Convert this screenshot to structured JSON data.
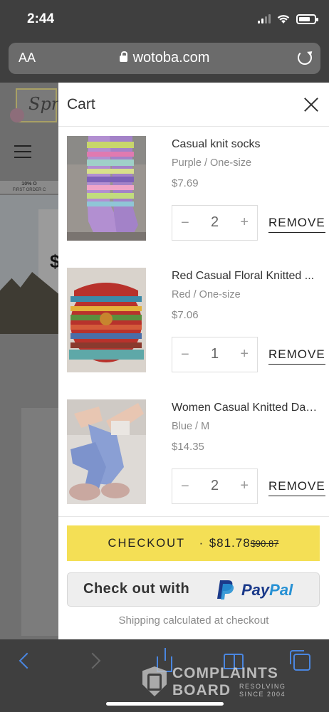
{
  "status_bar": {
    "time": "2:44"
  },
  "browser": {
    "text_size_label": "AA",
    "url": "wotoba.com"
  },
  "background_page": {
    "logo_text": "Spr",
    "promo_line_1": "10% O",
    "promo_line_2": "FIRST ORDER C",
    "hero_text": "$"
  },
  "cart": {
    "title": "Cart",
    "items": [
      {
        "name": "Casual knit socks",
        "variant": "Purple / One-size",
        "price": "$7.69",
        "quantity": "2",
        "remove_label": "REMOVE",
        "image": "knit-socks-image"
      },
      {
        "name": "Red Casual Floral Knitted ...",
        "variant": "Red / One-size",
        "price": "$7.06",
        "quantity": "1",
        "remove_label": "REMOVE",
        "image": "knit-hat-image"
      },
      {
        "name": "Women Casual Knitted Dai...",
        "variant": "Blue / M",
        "price": "$14.35",
        "quantity": "2",
        "remove_label": "REMOVE",
        "image": "knit-leg-warmers-image"
      }
    ],
    "qty_minus": "−",
    "qty_plus": "+",
    "checkout_label": "CHECKOUT",
    "checkout_separator": "·",
    "total": "$81.78",
    "original_total": "$90.87",
    "paypal_prefix": "Check out with",
    "paypal_brand_1": "Pay",
    "paypal_brand_2": "Pal",
    "shipping_note": "Shipping calculated at checkout"
  },
  "watermark": {
    "line_1": "COMPLAINTS",
    "line_2": "BOARD",
    "tag_1": "RESOLVING",
    "tag_2": "SINCE 2004"
  },
  "colors": {
    "checkout_bg": "#f4df55",
    "ios_blue": "#4a86e0",
    "paypal_dark": "#1b3a8a",
    "paypal_light": "#2791d4"
  }
}
